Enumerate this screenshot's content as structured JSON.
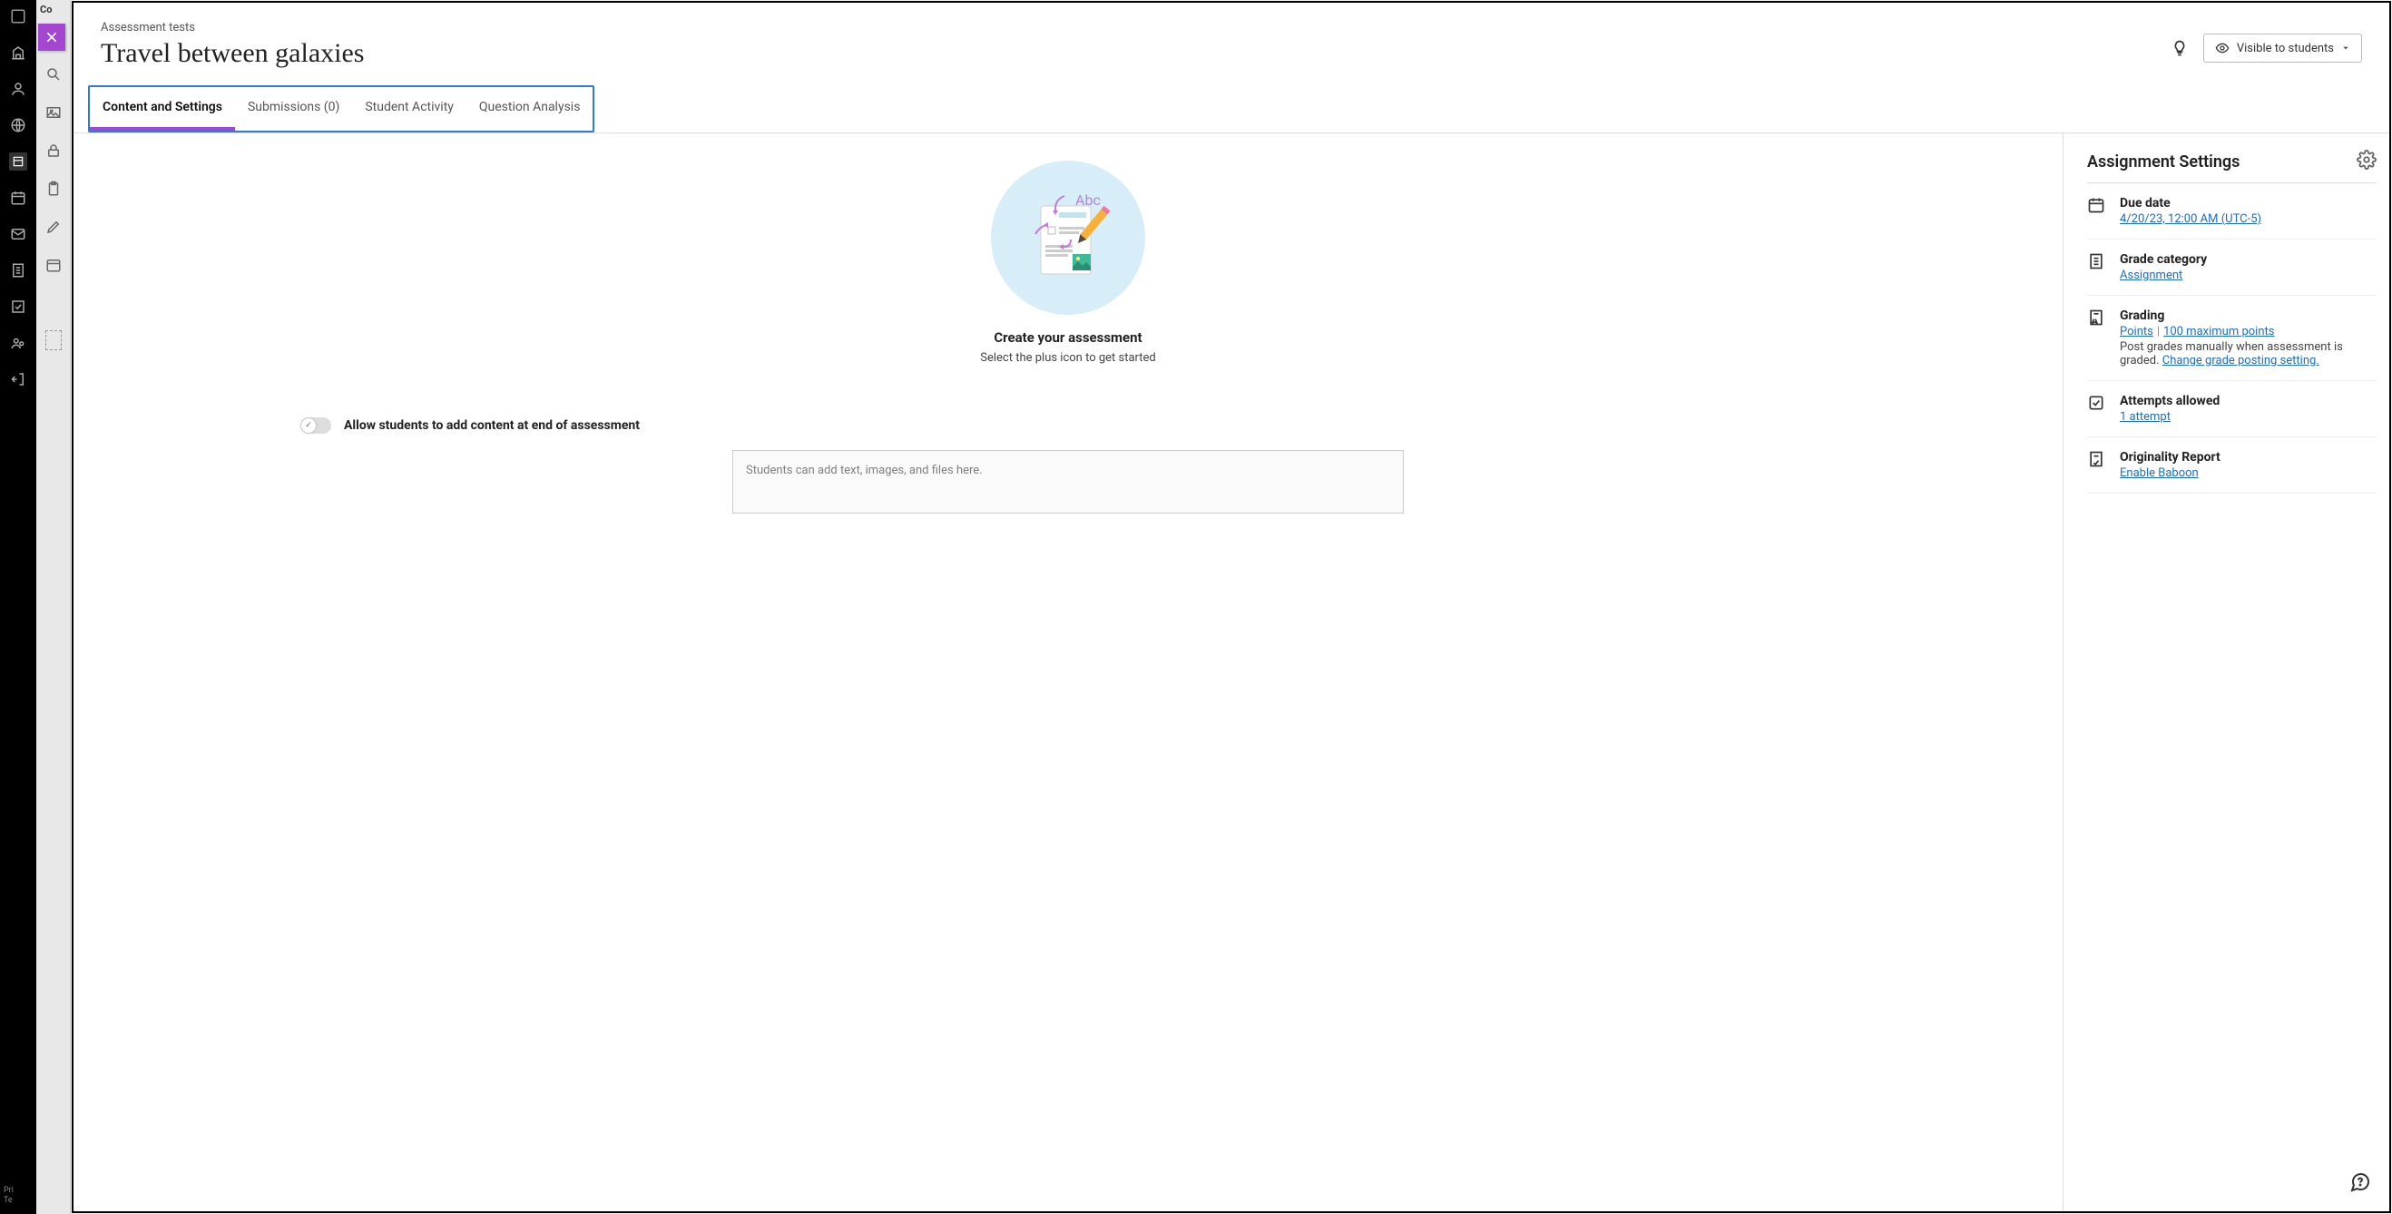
{
  "breadcrumb": "Assessment tests",
  "title": "Travel between galaxies",
  "visibility_label": "Visible to students",
  "tabs": {
    "content": "Content and Settings",
    "submissions": "Submissions (0)",
    "activity": "Student Activity",
    "analysis": "Question Analysis"
  },
  "create": {
    "heading": "Create your assessment",
    "sub": "Select the plus icon to get started"
  },
  "allow_label": "Allow students to add content at end of assessment",
  "add_placeholder": "Students can add text, images, and files here.",
  "settings": {
    "title": "Assignment Settings",
    "due": {
      "label": "Due date",
      "value": "4/20/23, 12:00 AM (UTC-5)"
    },
    "category": {
      "label": "Grade category",
      "value": "Assignment"
    },
    "grading": {
      "label": "Grading",
      "points": "Points",
      "max": "100 maximum points",
      "desc": "Post grades manually when assessment is graded.",
      "change": "Change grade posting setting."
    },
    "attempts": {
      "label": "Attempts allowed",
      "value": "1 attempt"
    },
    "originality": {
      "label": "Originality Report",
      "value": "Enable Baboon"
    }
  },
  "footer": {
    "l1": "Pri",
    "l2": "Te"
  },
  "rail_top": "Co"
}
